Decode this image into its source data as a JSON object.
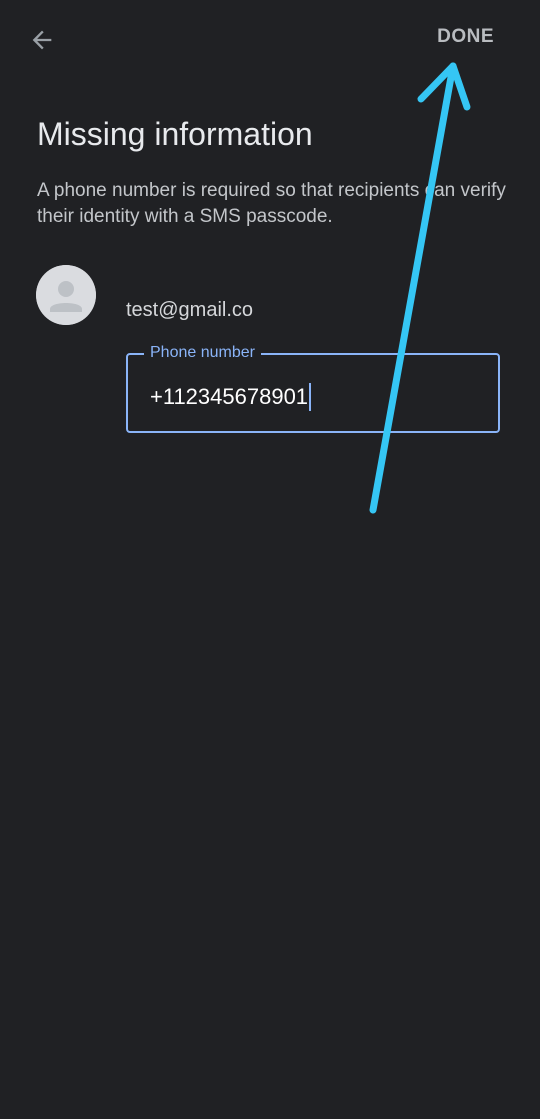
{
  "header": {
    "back_icon": "arrow-left-icon",
    "done_label": "DONE"
  },
  "main": {
    "title": "Missing information",
    "description": "A phone number is required so that recipients can verify their identity with a SMS passcode."
  },
  "recipient": {
    "avatar_icon": "person-avatar-icon",
    "email": "test@gmail.co"
  },
  "phone_field": {
    "label": "Phone number",
    "value": "+112345678901"
  },
  "colors": {
    "background": "#202124",
    "accent": "#8ab4f8",
    "annotation_arrow": "#35c6f4"
  }
}
